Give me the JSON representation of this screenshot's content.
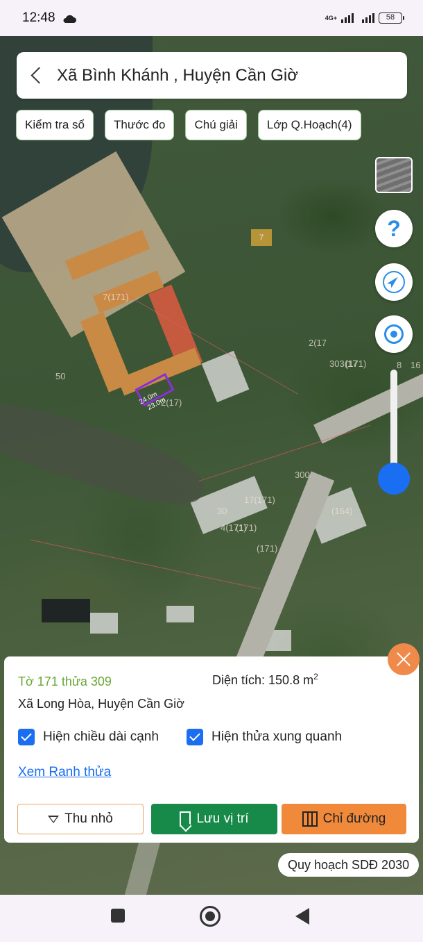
{
  "status": {
    "time": "12:48",
    "network": "4G+",
    "battery": "58"
  },
  "header": {
    "title": "Xã Bình Khánh , Huyện Cần Giờ"
  },
  "chips": [
    "Kiểm tra sổ",
    "Thước đo",
    "Chú giải",
    "Lớp Q.Hoạch(4)"
  ],
  "map": {
    "labels": [
      "7(171)",
      "2(17",
      "303(17",
      "(171)",
      "8",
      "16",
      "300",
      "(164)",
      "17(171)",
      "30",
      "4(171)",
      "(171)",
      "(171)",
      "50",
      "2(17)"
    ],
    "parcel": {
      "side_a": "24.0m",
      "side_b": "23.0m"
    },
    "plot_marker": "7"
  },
  "controls": {
    "help": "?"
  },
  "panel": {
    "parcel_id": "Tờ 171 thửa 309",
    "area_label": "Diện tích: 150.8 m",
    "area_unit_sup": "2",
    "address": "Xã Long Hòa, Huyện Cần Giờ",
    "check_edge_length": "Hiện chiều dài cạnh",
    "check_neighbors": "Hiện thửa xung quanh",
    "link_boundary": "Xem Ranh thửa",
    "btn_shrink": "Thu nhỏ",
    "btn_save": "Lưu vị trí",
    "btn_directions": "Chỉ đường"
  },
  "plan_tag": "Quy hoạch SDĐ 2030"
}
